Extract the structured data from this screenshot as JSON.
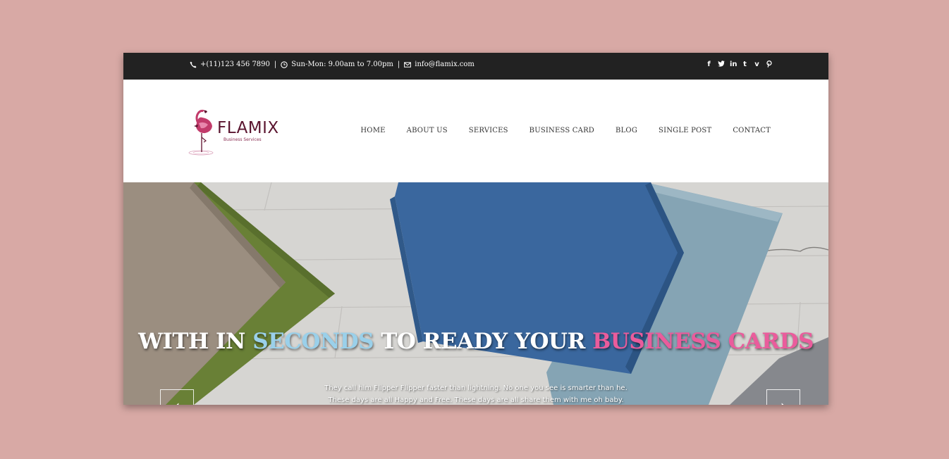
{
  "topbar": {
    "phone": "+(11)123 456 7890",
    "hours": "Sun-Mon: 9.00am to 7.00pm",
    "email": "info@flamix.com",
    "separator": "|",
    "social": [
      {
        "icon": "facebook-icon",
        "glyph": "f"
      },
      {
        "icon": "twitter-icon",
        "glyph": "🐦"
      },
      {
        "icon": "linkedin-icon",
        "glyph": "in"
      },
      {
        "icon": "tumblr-icon",
        "glyph": "t"
      },
      {
        "icon": "vimeo-icon",
        "glyph": "v"
      },
      {
        "icon": "pinterest-icon",
        "glyph": "℗"
      }
    ]
  },
  "logo": {
    "name": "FLAMIX",
    "tagline": "Business Services"
  },
  "nav": {
    "home": "HOME",
    "about": "ABOUT US",
    "services": "SERVICES",
    "business_card": "BUSINESS CARD",
    "blog": "BLOG",
    "single_post": "SINGLE POST",
    "contact": "CONTACT"
  },
  "hero": {
    "headline_part1": "WITH IN ",
    "headline_highlight1": "SECONDS",
    "headline_part2": " TO READY YOUR ",
    "headline_highlight2": "BUSINESS CARDS",
    "subtext": "They call him Flipper Flipper faster than lightning. No one you see is smarter than he. These days are all Happy and Free. These days are all share them with me oh baby.",
    "prev_arrow": "‹",
    "next_arrow": "›"
  },
  "colors": {
    "page_bg": "#d8a9a5",
    "topbar_bg": "#222222",
    "brand": "#5b1630",
    "highlight_blue": "#9ad0ea",
    "highlight_pink": "#ea5c9c"
  }
}
